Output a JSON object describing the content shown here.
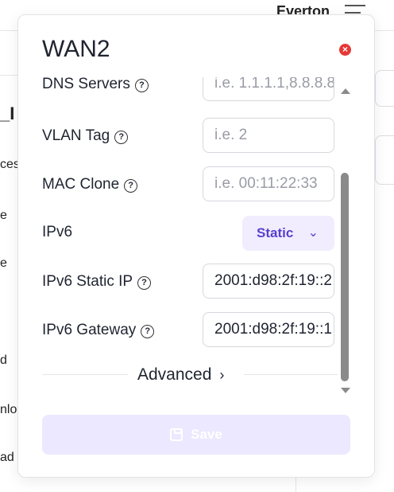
{
  "background": {
    "user_name": "Everton",
    "fragments": [
      "_I",
      "ces",
      "e",
      "e",
      "d",
      "nlo",
      "ad"
    ]
  },
  "modal": {
    "title": "WAN2",
    "close_icon": "close-icon",
    "fields": [
      {
        "label": "DNS Servers",
        "placeholder": "i.e. 1.1.1.1,8.8.8.8"
      },
      {
        "label": "VLAN Tag",
        "placeholder": "i.e. 2"
      },
      {
        "label": "MAC Clone",
        "placeholder": "i.e. 00:11:22:33"
      },
      {
        "label": "IPv6",
        "selected": "Static"
      },
      {
        "label": "IPv6 Static IP",
        "value": "2001:d98:2f:19::2"
      },
      {
        "label": "IPv6 Gateway",
        "value": "2001:d98:2f:19::1"
      }
    ],
    "help_glyph": "?",
    "advanced_label": "Advanced",
    "save_label": "Save"
  },
  "colors": {
    "accent": "#5a3fcf",
    "accent_light": "#f1edff",
    "save_disabled": "#ece8ff",
    "close": "#e53935"
  }
}
